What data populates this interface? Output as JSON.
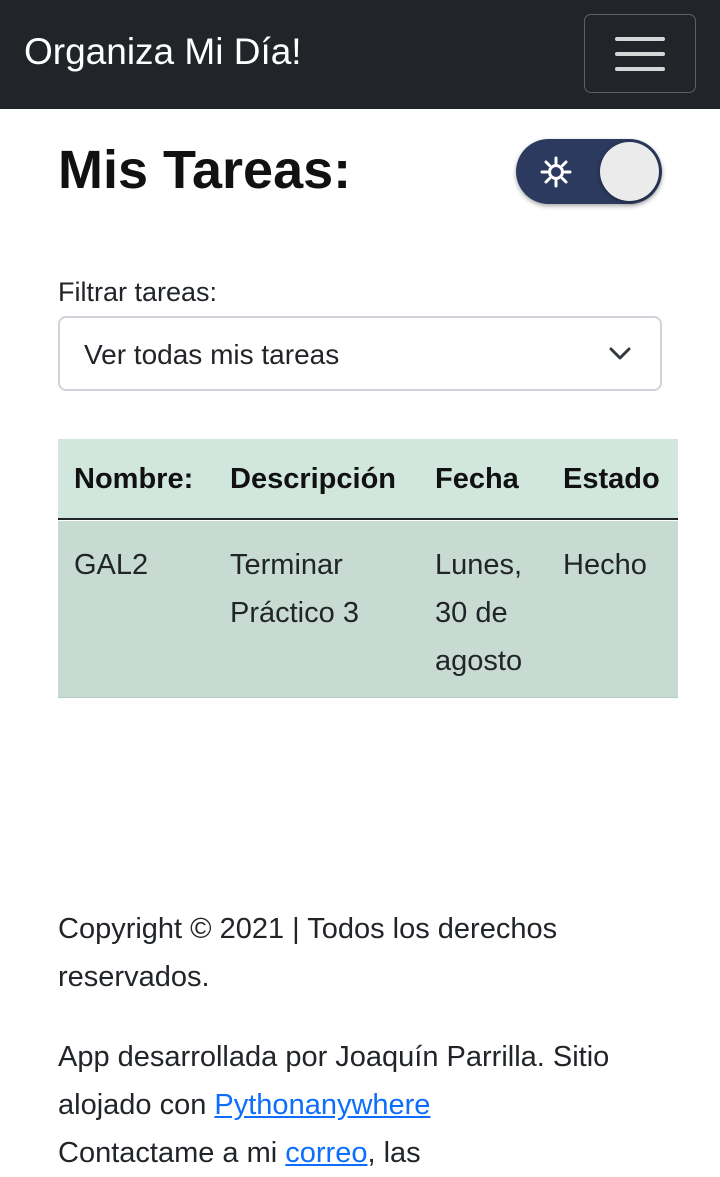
{
  "navbar": {
    "brand": "Organiza Mi Día!",
    "menu_icon": "hamburger-menu-icon"
  },
  "page": {
    "title": "Mis Tareas:",
    "theme_toggle_icon": "sun-icon",
    "theme_toggle_state": "on"
  },
  "filter": {
    "label": "Filtrar tareas:",
    "selected": "Ver todas mis tareas",
    "icon": "chevron-down-icon"
  },
  "table": {
    "headers": [
      "Nombre:",
      "Descripción",
      "Fecha",
      "Estado"
    ],
    "rows": [
      [
        "GAL2",
        "Terminar Práctico 3",
        "Lunes, 30 de agosto",
        "Hecho"
      ]
    ]
  },
  "footer": {
    "copyright": "Copyright © 2021 | Todos los derechos reservados.",
    "credit_text": "App desarrollada por Joaquín Parrilla. Sitio alojado con ",
    "host_link": "Pythonanywhere",
    "contact_prefix": "Contactame a mi ",
    "contact_link": "correo",
    "contact_suffix": ", las"
  },
  "colors": {
    "navbar_bg": "#212529",
    "table_header_bg": "#d1e7dd",
    "table_row_bg": "#c7dbd2",
    "switch_bg": "#2b3a5e",
    "link": "#0d6efd"
  }
}
